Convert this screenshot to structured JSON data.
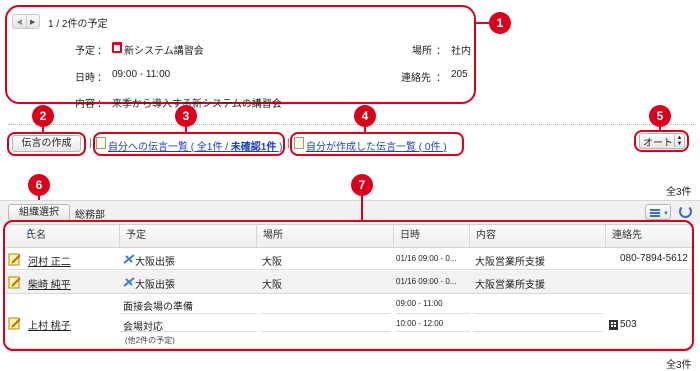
{
  "schedule_panel": {
    "pager_text": "1 / 2件の予定",
    "yotei_label": "予定",
    "yotei_value": "新システム講習会",
    "basho_label": "場所",
    "basho_value": "社内",
    "nichiji_label": "日時",
    "nichiji_value": "09:00 - 11:00",
    "renrakusaki_label": "連絡先",
    "renrakusaki_value": "205",
    "naiyou_label": "内容",
    "naiyou_value": "来季から導入する新システムの講習会",
    "colon": "："
  },
  "actions": {
    "create_memo_button": "伝言の作成",
    "separator": "|",
    "my_messages_link_prefix": "自分への伝言一覧 ( 全1件 / ",
    "my_messages_link_unread": "未確認1件",
    "my_messages_link_suffix": " )",
    "created_messages_link": "自分が作成した伝言一覧 ( 0件 )",
    "auto_select_value": "オート"
  },
  "badges": [
    "1",
    "2",
    "3",
    "4",
    "5",
    "6",
    "7"
  ],
  "counts": {
    "top": "全3件",
    "bottom": "全3件"
  },
  "org_bar": {
    "org_select_button": "組織選択",
    "department": "総務部"
  },
  "table": {
    "headers": [
      "氏名",
      "予定",
      "場所",
      "日時",
      "内容",
      "連絡先"
    ],
    "rows": [
      {
        "name": "河村 正二",
        "plan": "大阪出張",
        "place": "大阪",
        "datetime": "01/16 09:00 - 0...",
        "content": "大阪営業所支援",
        "contact": "080-7894-5612"
      },
      {
        "name": "柴崎 純平",
        "plan": "大阪出張",
        "place": "大阪",
        "datetime": "01/16 09:00 - 0...",
        "content": "大阪営業所支援",
        "contact": ""
      },
      {
        "name": "上村 桃子",
        "plan1": "面接会場の準備",
        "time1": "09:00 - 11:00",
        "plan2": "会場対応",
        "time2": "10:00 - 12:00",
        "other": "(他2件の予定)",
        "contact": "503"
      }
    ]
  },
  "colors": {
    "accent_red": "#d9001b",
    "link_blue": "#1a3fc2",
    "row_alt": "#f2f2f2"
  }
}
